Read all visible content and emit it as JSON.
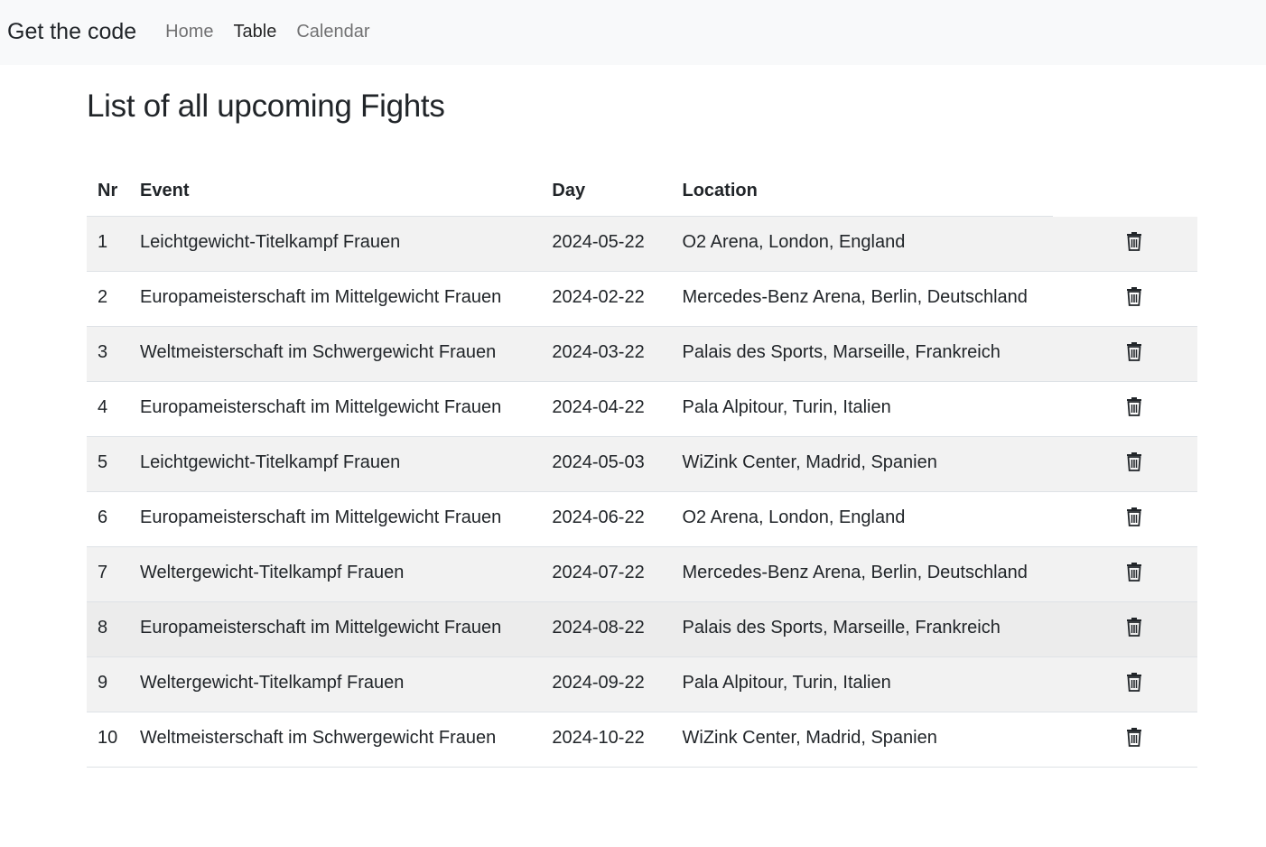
{
  "navbar": {
    "brand": "Get the code",
    "links": [
      {
        "label": "Home",
        "active": false
      },
      {
        "label": "Table",
        "active": true
      },
      {
        "label": "Calendar",
        "active": false
      }
    ]
  },
  "page": {
    "title": "List of all upcoming Fights"
  },
  "table": {
    "headers": {
      "nr": "Nr",
      "event": "Event",
      "day": "Day",
      "location": "Location"
    },
    "action_icon": "trash-icon",
    "rows": [
      {
        "nr": "1",
        "event": "Leichtgewicht-Titelkampf Frauen",
        "day": "2024-05-22",
        "location": "O2 Arena, London, England"
      },
      {
        "nr": "2",
        "event": "Europameisterschaft im Mittelgewicht Frauen",
        "day": "2024-02-22",
        "location": "Mercedes-Benz Arena, Berlin, Deutschland"
      },
      {
        "nr": "3",
        "event": "Weltmeisterschaft im Schwergewicht Frauen",
        "day": "2024-03-22",
        "location": "Palais des Sports, Marseille, Frankreich"
      },
      {
        "nr": "4",
        "event": "Europameisterschaft im Mittelgewicht Frauen",
        "day": "2024-04-22",
        "location": "Pala Alpitour, Turin, Italien"
      },
      {
        "nr": "5",
        "event": "Leichtgewicht-Titelkampf Frauen",
        "day": "2024-05-03",
        "location": "WiZink Center, Madrid, Spanien"
      },
      {
        "nr": "6",
        "event": "Europameisterschaft im Mittelgewicht Frauen",
        "day": "2024-06-22",
        "location": "O2 Arena, London, England"
      },
      {
        "nr": "7",
        "event": "Weltergewicht-Titelkampf Frauen",
        "day": "2024-07-22",
        "location": "Mercedes-Benz Arena, Berlin, Deutschland"
      },
      {
        "nr": "8",
        "event": "Europameisterschaft im Mittelgewicht Frauen",
        "day": "2024-08-22",
        "location": "Palais des Sports, Marseille, Frankreich"
      },
      {
        "nr": "9",
        "event": "Weltergewicht-Titelkampf Frauen",
        "day": "2024-09-22",
        "location": "Pala Alpitour, Turin, Italien"
      },
      {
        "nr": "10",
        "event": "Weltmeisterschaft im Schwergewicht Frauen",
        "day": "2024-10-22",
        "location": "WiZink Center, Madrid, Spanien"
      }
    ]
  }
}
